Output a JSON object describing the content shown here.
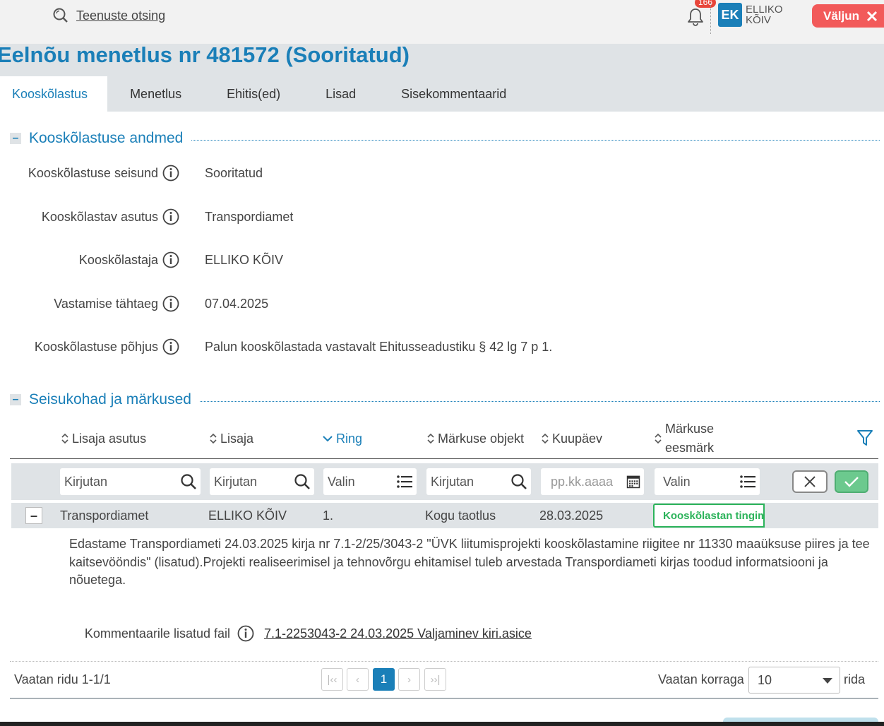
{
  "topbar": {
    "search_label": "Teenuste otsing",
    "notification_count": "166",
    "user_initials": "EK",
    "user_name": "ELLIKO KÕIV",
    "logout_label": "Väljun"
  },
  "page": {
    "title": "Eelnõu menetlus nr 481572 (Sooritatud)"
  },
  "tabs": [
    {
      "label": "Kooskõlastus",
      "active": true
    },
    {
      "label": "Menetlus",
      "active": false
    },
    {
      "label": "Ehitis(ed)",
      "active": false
    },
    {
      "label": "Lisad",
      "active": false
    },
    {
      "label": "Sisekommentaarid",
      "active": false
    }
  ],
  "section_approval": {
    "title": "Kooskõlastuse andmed",
    "fields": [
      {
        "label": "Kooskõlastuse seisund",
        "value": "Sooritatud"
      },
      {
        "label": "Kooskõlastav asutus",
        "value": "Transpordiamet"
      },
      {
        "label": "Kooskõlastaja",
        "value": "ELLIKO KÕIV"
      },
      {
        "label": "Vastamise tähtaeg",
        "value": "07.04.2025"
      },
      {
        "label": "Kooskõlastuse põhjus",
        "value": "Palun kooskõlastada vastavalt Ehitusseadustiku § 42 lg 7 p 1."
      }
    ]
  },
  "section_remarks": {
    "title": "Seisukohad ja märkused",
    "columns": [
      {
        "label": "Lisaja asutus",
        "sort": "none"
      },
      {
        "label": "Lisaja",
        "sort": "none"
      },
      {
        "label": "Ring",
        "sort": "desc"
      },
      {
        "label": "Märkuse objekt",
        "sort": "none"
      },
      {
        "label": "Kuupäev",
        "sort": "none"
      },
      {
        "label": "Märkuse eesmärk",
        "sort": "none"
      }
    ],
    "filters": {
      "asutus_placeholder": "Kirjutan",
      "lisaja_placeholder": "Kirjutan",
      "ring_placeholder": "Valin",
      "objekt_placeholder": "Kirjutan",
      "kuupaev_placeholder": "pp.kk.aaaa",
      "eesmark_placeholder": "Valin"
    },
    "row": {
      "asutus": "Transpordiamet",
      "lisaja": "ELLIKO KÕIV",
      "ring": "1.",
      "objekt": "Kogu taotlus",
      "kuupaev": "28.03.2025",
      "eesmark": "Kooskõlastan tingimustega",
      "detail": "Edastame Transpordiameti  24.03.2025 kirja nr 7.1-2/25/3043-2 \"ÜVK liitumisprojekti kooskõlastamine riigitee nr 11330 maaüksuse piires ja tee kaitsevööndis\" (lisatud).Projekti realiseerimisel ja tehnovõrgu ehitamisel tuleb arvestada Transpordiameti kirjas toodud informatsiooni ja nõuetega.",
      "attachment_label": "Kommentaarile lisatud fail",
      "attachment_file": "7.1-2253043-2 24.03.2025 Valjaminev kiri.asice"
    },
    "pager": {
      "info": "Vaatan ridu 1-1/1",
      "current_page": "1",
      "per_page_label": "Vaatan korraga",
      "per_page_value": "10",
      "per_page_suffix": "rida"
    }
  },
  "colors": {
    "accent": "#1a7fb8",
    "success": "#2bb35a",
    "danger": "#f25a5a",
    "band": "#dfe3e6"
  }
}
